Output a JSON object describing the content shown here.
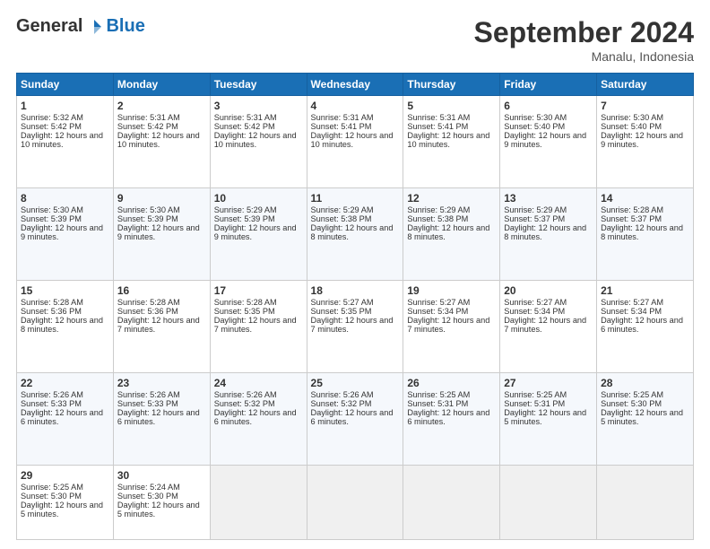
{
  "header": {
    "logo_general": "General",
    "logo_blue": "Blue",
    "title": "September 2024",
    "location": "Manalu, Indonesia"
  },
  "days_of_week": [
    "Sunday",
    "Monday",
    "Tuesday",
    "Wednesday",
    "Thursday",
    "Friday",
    "Saturday"
  ],
  "weeks": [
    [
      {
        "day": 1,
        "sunrise": "5:32 AM",
        "sunset": "5:42 PM",
        "daylight": "12 hours and 10 minutes."
      },
      {
        "day": 2,
        "sunrise": "5:31 AM",
        "sunset": "5:42 PM",
        "daylight": "12 hours and 10 minutes."
      },
      {
        "day": 3,
        "sunrise": "5:31 AM",
        "sunset": "5:42 PM",
        "daylight": "12 hours and 10 minutes."
      },
      {
        "day": 4,
        "sunrise": "5:31 AM",
        "sunset": "5:41 PM",
        "daylight": "12 hours and 10 minutes."
      },
      {
        "day": 5,
        "sunrise": "5:31 AM",
        "sunset": "5:41 PM",
        "daylight": "12 hours and 10 minutes."
      },
      {
        "day": 6,
        "sunrise": "5:30 AM",
        "sunset": "5:40 PM",
        "daylight": "12 hours and 9 minutes."
      },
      {
        "day": 7,
        "sunrise": "5:30 AM",
        "sunset": "5:40 PM",
        "daylight": "12 hours and 9 minutes."
      }
    ],
    [
      {
        "day": 8,
        "sunrise": "5:30 AM",
        "sunset": "5:39 PM",
        "daylight": "12 hours and 9 minutes."
      },
      {
        "day": 9,
        "sunrise": "5:30 AM",
        "sunset": "5:39 PM",
        "daylight": "12 hours and 9 minutes."
      },
      {
        "day": 10,
        "sunrise": "5:29 AM",
        "sunset": "5:39 PM",
        "daylight": "12 hours and 9 minutes."
      },
      {
        "day": 11,
        "sunrise": "5:29 AM",
        "sunset": "5:38 PM",
        "daylight": "12 hours and 8 minutes."
      },
      {
        "day": 12,
        "sunrise": "5:29 AM",
        "sunset": "5:38 PM",
        "daylight": "12 hours and 8 minutes."
      },
      {
        "day": 13,
        "sunrise": "5:29 AM",
        "sunset": "5:37 PM",
        "daylight": "12 hours and 8 minutes."
      },
      {
        "day": 14,
        "sunrise": "5:28 AM",
        "sunset": "5:37 PM",
        "daylight": "12 hours and 8 minutes."
      }
    ],
    [
      {
        "day": 15,
        "sunrise": "5:28 AM",
        "sunset": "5:36 PM",
        "daylight": "12 hours and 8 minutes."
      },
      {
        "day": 16,
        "sunrise": "5:28 AM",
        "sunset": "5:36 PM",
        "daylight": "12 hours and 7 minutes."
      },
      {
        "day": 17,
        "sunrise": "5:28 AM",
        "sunset": "5:35 PM",
        "daylight": "12 hours and 7 minutes."
      },
      {
        "day": 18,
        "sunrise": "5:27 AM",
        "sunset": "5:35 PM",
        "daylight": "12 hours and 7 minutes."
      },
      {
        "day": 19,
        "sunrise": "5:27 AM",
        "sunset": "5:34 PM",
        "daylight": "12 hours and 7 minutes."
      },
      {
        "day": 20,
        "sunrise": "5:27 AM",
        "sunset": "5:34 PM",
        "daylight": "12 hours and 7 minutes."
      },
      {
        "day": 21,
        "sunrise": "5:27 AM",
        "sunset": "5:34 PM",
        "daylight": "12 hours and 6 minutes."
      }
    ],
    [
      {
        "day": 22,
        "sunrise": "5:26 AM",
        "sunset": "5:33 PM",
        "daylight": "12 hours and 6 minutes."
      },
      {
        "day": 23,
        "sunrise": "5:26 AM",
        "sunset": "5:33 PM",
        "daylight": "12 hours and 6 minutes."
      },
      {
        "day": 24,
        "sunrise": "5:26 AM",
        "sunset": "5:32 PM",
        "daylight": "12 hours and 6 minutes."
      },
      {
        "day": 25,
        "sunrise": "5:26 AM",
        "sunset": "5:32 PM",
        "daylight": "12 hours and 6 minutes."
      },
      {
        "day": 26,
        "sunrise": "5:25 AM",
        "sunset": "5:31 PM",
        "daylight": "12 hours and 6 minutes."
      },
      {
        "day": 27,
        "sunrise": "5:25 AM",
        "sunset": "5:31 PM",
        "daylight": "12 hours and 5 minutes."
      },
      {
        "day": 28,
        "sunrise": "5:25 AM",
        "sunset": "5:30 PM",
        "daylight": "12 hours and 5 minutes."
      }
    ],
    [
      {
        "day": 29,
        "sunrise": "5:25 AM",
        "sunset": "5:30 PM",
        "daylight": "12 hours and 5 minutes."
      },
      {
        "day": 30,
        "sunrise": "5:24 AM",
        "sunset": "5:30 PM",
        "daylight": "12 hours and 5 minutes."
      },
      null,
      null,
      null,
      null,
      null
    ]
  ]
}
